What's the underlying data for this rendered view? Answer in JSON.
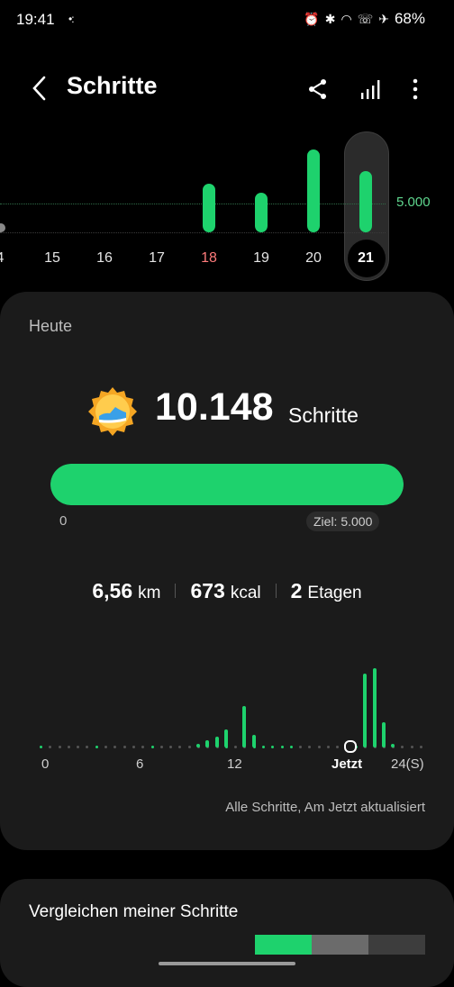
{
  "status": {
    "time": "19:41",
    "battery": "68%"
  },
  "header": {
    "title": "Schritte"
  },
  "week": {
    "goal_label": "5.000",
    "days": [
      {
        "label": "4",
        "steps": 0,
        "weekend": false
      },
      {
        "label": "15",
        "steps": 0,
        "weekend": false
      },
      {
        "label": "16",
        "steps": 0,
        "weekend": false
      },
      {
        "label": "17",
        "steps": 0,
        "weekend": false
      },
      {
        "label": "18",
        "steps": 5600,
        "weekend": true
      },
      {
        "label": "19",
        "steps": 4500,
        "weekend": false
      },
      {
        "label": "20",
        "steps": 9500,
        "weekend": false
      },
      {
        "label": "21",
        "steps": 7000,
        "weekend": false
      }
    ],
    "selected": "21"
  },
  "today": {
    "heading": "Heute",
    "steps": "10.148",
    "steps_unit": "Schritte",
    "progress_start": "0",
    "goal_chip": "Ziel: 5.000",
    "progress_fraction": 1.0,
    "stats": [
      {
        "value": "6,56",
        "unit": "km"
      },
      {
        "value": "673",
        "unit": "kcal"
      },
      {
        "value": "2",
        "unit": "Etagen"
      }
    ],
    "hour_axis": [
      "0",
      "6",
      "12",
      "Jetzt",
      "24(S)"
    ],
    "updated": "Alle Schritte, Am Jetzt aktualisiert"
  },
  "compare": {
    "title": "Vergleichen meiner Schritte"
  },
  "colors": {
    "accent": "#1ed26d",
    "card": "#1b1b1b",
    "weekend": "#ff7b7b"
  }
}
